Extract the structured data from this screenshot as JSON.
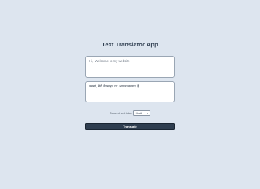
{
  "app": {
    "title": "Text Translator App"
  },
  "input": {
    "value": "Hi,  Welcome to my website"
  },
  "output": {
    "value": "नमस्ते, मेरी वेबसाइट पर आपका स्वागत है"
  },
  "language": {
    "label": "Convert text into",
    "selected": "Hindi"
  },
  "actions": {
    "translate_label": "Translate"
  },
  "colors": {
    "background": "#dde5ef",
    "primary": "#2f3e50"
  }
}
